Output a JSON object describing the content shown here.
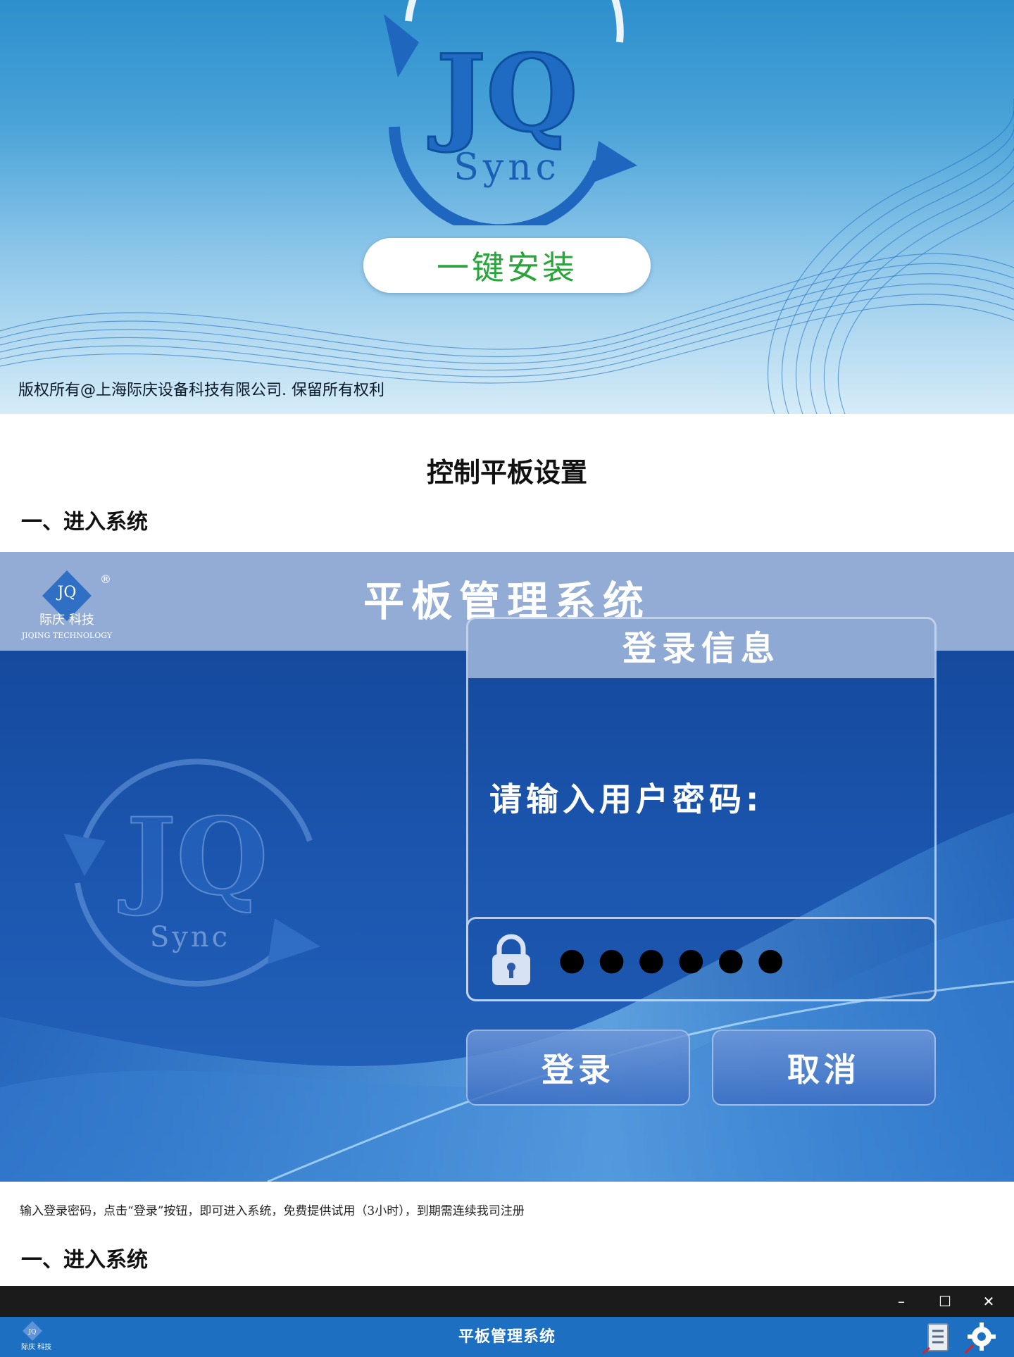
{
  "hero": {
    "logo_text": "JQ",
    "logo_subtext": "Sync",
    "install_button": "一键安装",
    "copyright": "版权所有@上海际庆设备科技有限公司. 保留所有权利"
  },
  "document": {
    "title": "控制平板设置",
    "section_1": "一、进入系统",
    "note": "输入登录密码，点击“登录”按钮，即可进入系统，免费提供试用（3小时），到期需连续我司注册",
    "section_2": "一、进入系统"
  },
  "login_screen": {
    "brand_logo_text": "JQ",
    "brand_cn": "际庆  科技",
    "brand_en": "JIQING TECHNOLOGY",
    "registered_mark": "®",
    "header_title": "平板管理系统",
    "watermark_text": "JQ",
    "watermark_subtext": "Sync",
    "panel_title": "登录信息",
    "password_label": "请输入用户密码:",
    "password_masked": "●●●●●●",
    "login_button": "登录",
    "cancel_button": "取消"
  },
  "app_window": {
    "window_controls": {
      "minimize": "–",
      "maximize": "☐",
      "close": "✕"
    },
    "header_title": "平板管理系统",
    "icons": [
      "list-icon",
      "gear-icon"
    ]
  },
  "colors": {
    "install_text": "#2aa53c",
    "login_header": "#92acd6",
    "login_body": "#1c57b0",
    "app_header": "#1d6fc2",
    "titlebar": "#1b1b1b"
  }
}
